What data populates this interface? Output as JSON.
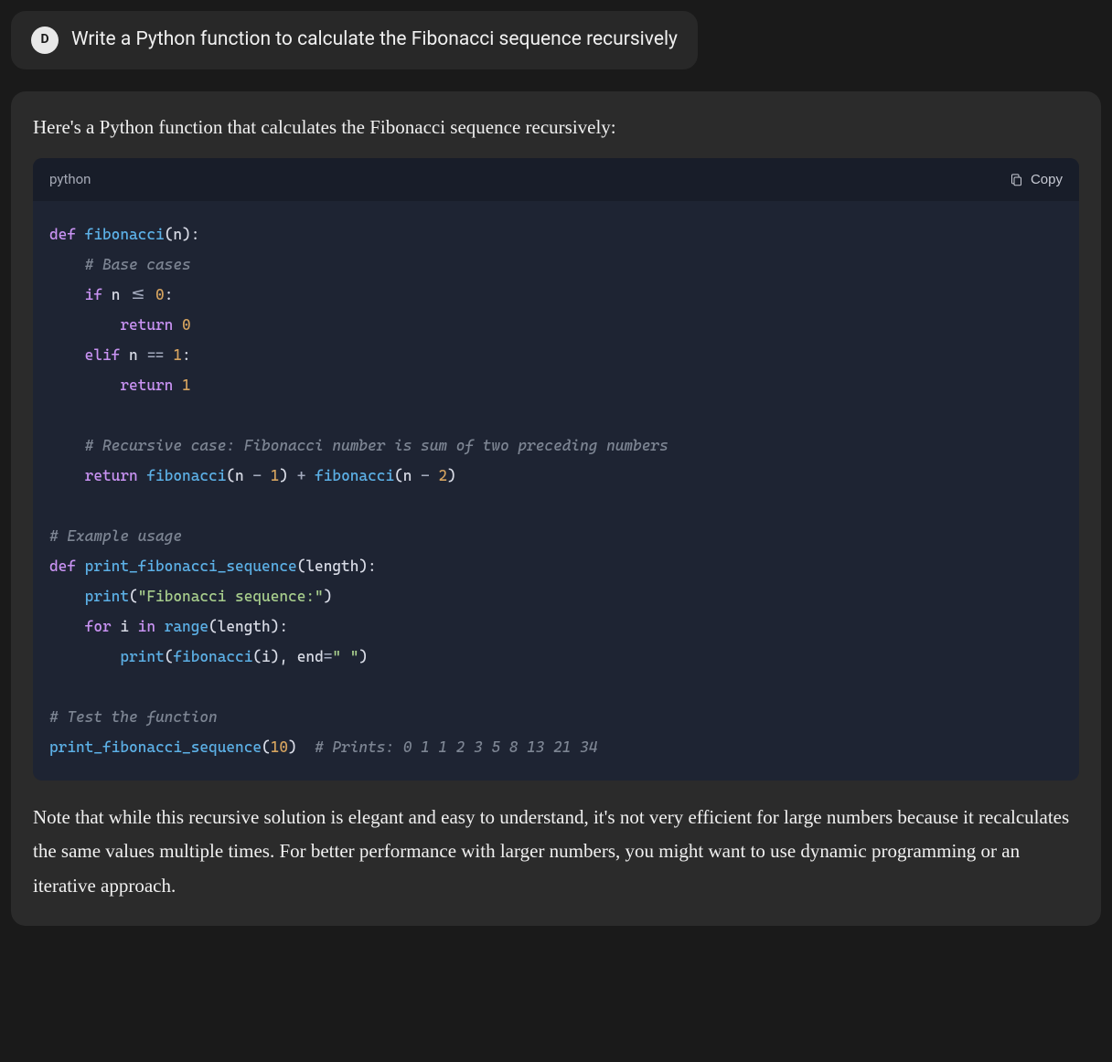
{
  "user": {
    "avatar_letter": "D",
    "message": "Write a Python function to calculate the Fibonacci sequence recursively"
  },
  "assistant": {
    "intro": "Here's a Python function that calculates the Fibonacci sequence recursively:",
    "code": {
      "language": "python",
      "copy_label": "Copy",
      "lines": [
        {
          "type": "code",
          "tokens": [
            {
              "t": "def ",
              "c": "kw"
            },
            {
              "t": "fibonacci",
              "c": "fn"
            },
            {
              "t": "(",
              "c": "paren"
            },
            {
              "t": "n",
              "c": "param"
            },
            {
              "t": "):",
              "c": "paren"
            }
          ]
        },
        {
          "type": "code",
          "tokens": [
            {
              "t": "    "
            },
            {
              "t": "# Base cases",
              "c": "comment"
            }
          ]
        },
        {
          "type": "code",
          "tokens": [
            {
              "t": "    "
            },
            {
              "t": "if ",
              "c": "kw"
            },
            {
              "t": "n",
              "c": "param"
            },
            {
              "t": " <= ",
              "c": "op"
            },
            {
              "t": "0",
              "c": "num"
            },
            {
              "t": ":",
              "c": "paren"
            }
          ]
        },
        {
          "type": "code",
          "tokens": [
            {
              "t": "        "
            },
            {
              "t": "return ",
              "c": "kw"
            },
            {
              "t": "0",
              "c": "num"
            }
          ]
        },
        {
          "type": "code",
          "tokens": [
            {
              "t": "    "
            },
            {
              "t": "elif ",
              "c": "kw"
            },
            {
              "t": "n",
              "c": "param"
            },
            {
              "t": " == ",
              "c": "op"
            },
            {
              "t": "1",
              "c": "num"
            },
            {
              "t": ":",
              "c": "paren"
            }
          ]
        },
        {
          "type": "code",
          "tokens": [
            {
              "t": "        "
            },
            {
              "t": "return ",
              "c": "kw"
            },
            {
              "t": "1",
              "c": "num"
            }
          ]
        },
        {
          "type": "blank"
        },
        {
          "type": "code",
          "tokens": [
            {
              "t": "    "
            },
            {
              "t": "# Recursive case: Fibonacci number is sum of two preceding numbers",
              "c": "comment"
            }
          ]
        },
        {
          "type": "code",
          "tokens": [
            {
              "t": "    "
            },
            {
              "t": "return ",
              "c": "kw"
            },
            {
              "t": "fibonacci",
              "c": "fn"
            },
            {
              "t": "(",
              "c": "paren"
            },
            {
              "t": "n",
              "c": "param"
            },
            {
              "t": " - ",
              "c": "op"
            },
            {
              "t": "1",
              "c": "num"
            },
            {
              "t": ")",
              "c": "paren"
            },
            {
              "t": " + ",
              "c": "op"
            },
            {
              "t": "fibonacci",
              "c": "fn"
            },
            {
              "t": "(",
              "c": "paren"
            },
            {
              "t": "n",
              "c": "param"
            },
            {
              "t": " - ",
              "c": "op"
            },
            {
              "t": "2",
              "c": "num"
            },
            {
              "t": ")",
              "c": "paren"
            }
          ]
        },
        {
          "type": "blank"
        },
        {
          "type": "code",
          "tokens": [
            {
              "t": "# Example usage",
              "c": "comment"
            }
          ]
        },
        {
          "type": "code",
          "tokens": [
            {
              "t": "def ",
              "c": "kw"
            },
            {
              "t": "print_fibonacci_sequence",
              "c": "fn"
            },
            {
              "t": "(",
              "c": "paren"
            },
            {
              "t": "length",
              "c": "param"
            },
            {
              "t": "):",
              "c": "paren"
            }
          ]
        },
        {
          "type": "code",
          "tokens": [
            {
              "t": "    "
            },
            {
              "t": "print",
              "c": "builtin"
            },
            {
              "t": "(",
              "c": "paren"
            },
            {
              "t": "\"Fibonacci sequence:\"",
              "c": "str"
            },
            {
              "t": ")",
              "c": "paren"
            }
          ]
        },
        {
          "type": "code",
          "tokens": [
            {
              "t": "    "
            },
            {
              "t": "for ",
              "c": "kw"
            },
            {
              "t": "i",
              "c": "param"
            },
            {
              "t": " in ",
              "c": "kw"
            },
            {
              "t": "range",
              "c": "builtin"
            },
            {
              "t": "(",
              "c": "paren"
            },
            {
              "t": "length",
              "c": "param"
            },
            {
              "t": "):",
              "c": "paren"
            }
          ]
        },
        {
          "type": "code",
          "tokens": [
            {
              "t": "        "
            },
            {
              "t": "print",
              "c": "builtin"
            },
            {
              "t": "(",
              "c": "paren"
            },
            {
              "t": "fibonacci",
              "c": "fn"
            },
            {
              "t": "(",
              "c": "paren"
            },
            {
              "t": "i",
              "c": "param"
            },
            {
              "t": ")",
              "c": "paren"
            },
            {
              "t": ", ",
              "c": "paren"
            },
            {
              "t": "end",
              "c": "param"
            },
            {
              "t": "=",
              "c": "op"
            },
            {
              "t": "\" \"",
              "c": "str"
            },
            {
              "t": ")",
              "c": "paren"
            }
          ]
        },
        {
          "type": "blank"
        },
        {
          "type": "code",
          "tokens": [
            {
              "t": "# Test the function",
              "c": "comment"
            }
          ]
        },
        {
          "type": "code",
          "tokens": [
            {
              "t": "print_fibonacci_sequence",
              "c": "fn"
            },
            {
              "t": "(",
              "c": "paren"
            },
            {
              "t": "10",
              "c": "num"
            },
            {
              "t": ")",
              "c": "paren"
            },
            {
              "t": "  "
            },
            {
              "t": "# Prints: 0 1 1 2 3 5 8 13 21 34",
              "c": "comment"
            }
          ]
        }
      ]
    },
    "note": "Note that while this recursive solution is elegant and easy to understand, it's not very efficient for large numbers because it recalculates the same values multiple times. For better performance with larger numbers, you might want to use dynamic programming or an iterative approach."
  }
}
